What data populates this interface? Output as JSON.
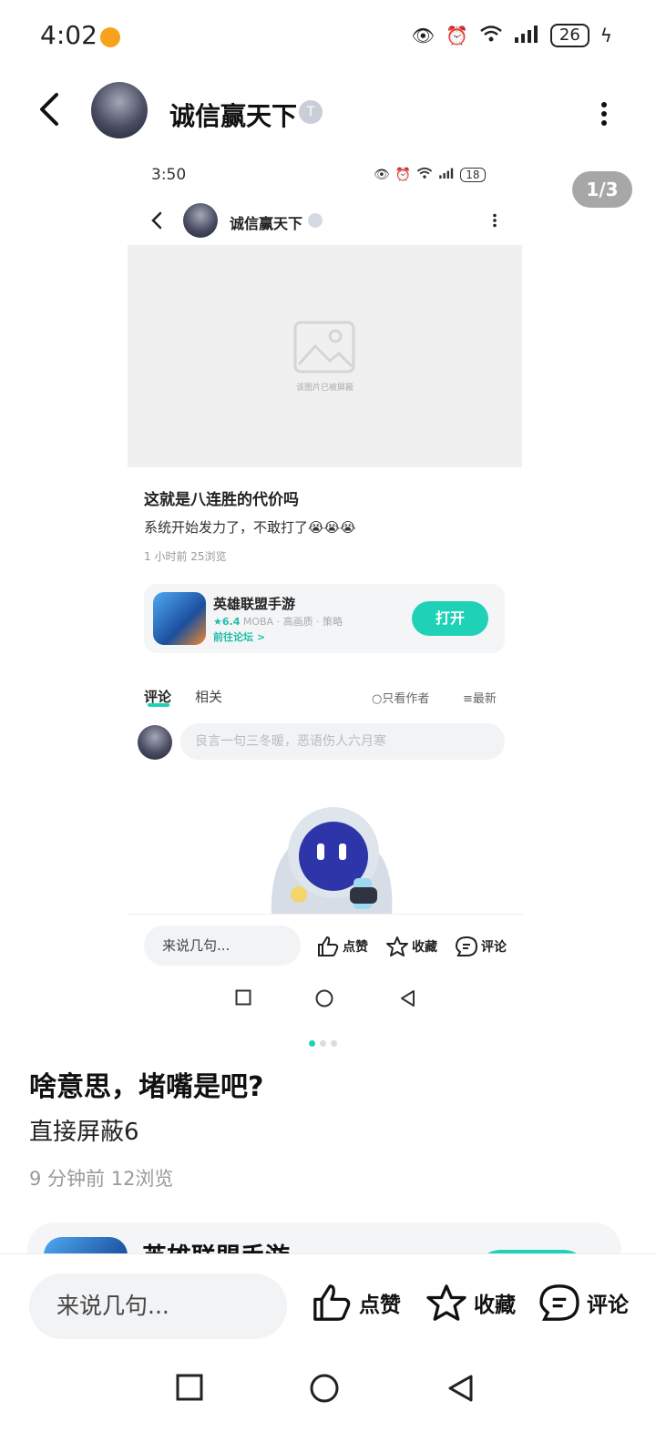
{
  "status_bar": {
    "time": "4:02",
    "battery": "26"
  },
  "header": {
    "user_name": "诚信赢天下",
    "level": "T"
  },
  "page_counter": "1/3",
  "embedded_screenshot": {
    "time": "3:50",
    "battery": "18",
    "user_name": "诚信赢天下",
    "blocked_text": "该图片已被屏蔽",
    "post_title": "这就是八连胜的代价吗",
    "post_body": "系统开始发力了，不敢打了😭😭😭",
    "post_meta": "1 小时前  25浏览",
    "game": {
      "name": "英雄联盟手游",
      "rating": "★6.4",
      "tags": "MOBA · 高画质 · 策略",
      "forum": "前往论坛 >",
      "open_label": "打开"
    },
    "tabs": {
      "comment": "评论",
      "related": "相关",
      "author_only": "只看作者",
      "latest": "最新"
    },
    "comment_placeholder": "良言一句三冬暖，恶语伤人六月寒",
    "say_placeholder": "来说几句...",
    "actions": {
      "like": "点赞",
      "collect": "收藏",
      "comment": "评论"
    }
  },
  "post": {
    "title": "啥意思，堵嘴是吧?",
    "body": "直接屏蔽6",
    "meta": "9 分钟前  12浏览"
  },
  "game_card": {
    "name": "英雄联盟手游"
  },
  "bottom_bar": {
    "say_placeholder": "来说几句...",
    "like": "点赞",
    "collect": "收藏",
    "comment": "评论"
  },
  "colors": {
    "accent": "#1fd2b7"
  }
}
